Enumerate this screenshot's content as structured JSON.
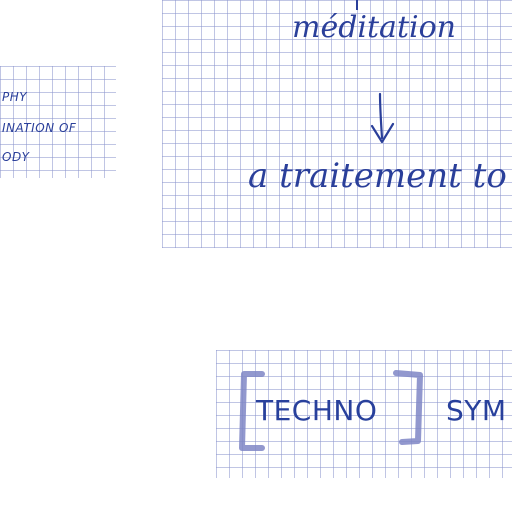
{
  "colors": {
    "ink": "#2a3f9a",
    "marker": "#7f86c6",
    "grid": "#8c96cd",
    "paper": "#ffffff"
  },
  "top_right": {
    "word_top": "méditation",
    "word_bottom": "a traitement to"
  },
  "left_note": {
    "line1": "PHY",
    "line2": "INATION OF",
    "line3": "ODY"
  },
  "bottom_note": {
    "word_bracket": "TECHNO",
    "word_next": "SYM"
  },
  "icons": {
    "arrow": "down-arrow-icon",
    "bracket_left": "left-bracket-icon",
    "bracket_right": "right-bracket-icon"
  }
}
